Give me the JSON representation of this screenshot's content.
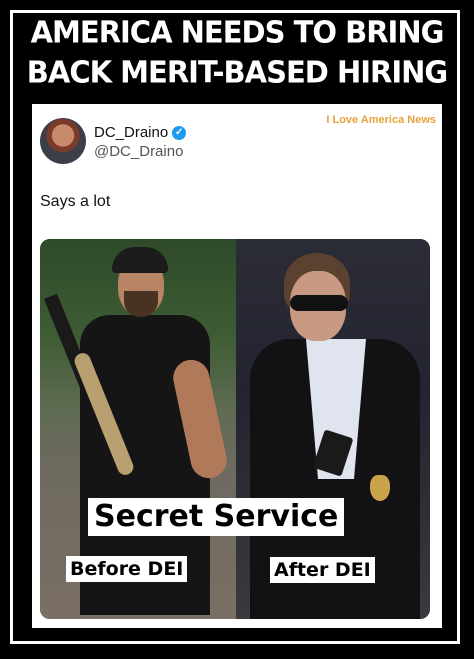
{
  "headline": {
    "line1": "AMERICA NEEDS TO BRING",
    "line2": "BACK MERIT-BASED HIRING"
  },
  "tweet": {
    "display_name": "DC_Draino",
    "handle": "@DC_Draino",
    "verified_icon": "verified-badge-icon",
    "text": "Says a lot",
    "watermark": "I Love America News"
  },
  "image_labels": {
    "title": "Secret Service",
    "left": "Before DEI",
    "right": "After DEI"
  },
  "colors": {
    "background": "#000000",
    "verified": "#1d9bf0",
    "watermark": "#e8a33a"
  }
}
